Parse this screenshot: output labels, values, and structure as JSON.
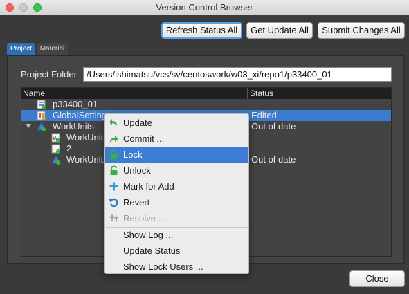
{
  "window": {
    "title": "Version Control Browser"
  },
  "toolbar": {
    "refresh_label": "Refresh Status All",
    "get_update_label": "Get Update All",
    "submit_label": "Submit Changes All"
  },
  "tabs": [
    {
      "label": "Project",
      "active": true
    },
    {
      "label": "Material",
      "active": false
    }
  ],
  "project_folder": {
    "label": "Project Folder",
    "value": "/Users/ishimatsu/vcs/sv/centoswork/w03_xi/repo1/p33400_01"
  },
  "tree": {
    "columns": {
      "name": "Name",
      "status": "Status"
    },
    "rows": [
      {
        "name": "p33400_01",
        "status": "",
        "icon": "project-file-icon",
        "selected": false
      },
      {
        "name": "GlobalSettings",
        "status": "Edited",
        "icon": "settings-file-icon",
        "selected": true
      },
      {
        "name": "WorkUnits",
        "status": "Out of date",
        "icon": "workunits-folder-icon",
        "selected": false,
        "expanded": true
      },
      {
        "name": "WorkUnits",
        "status": "",
        "icon": "workunit-file-icon",
        "selected": false
      },
      {
        "name": "2",
        "status": "",
        "icon": "document-icon",
        "selected": false
      },
      {
        "name": "WorkUnits",
        "status": "Out of date",
        "icon": "workunits-folder-icon",
        "selected": false
      }
    ]
  },
  "context_menu": {
    "items": [
      {
        "label": "Update",
        "icon": "update-arrow-icon",
        "enabled": true,
        "highlighted": false
      },
      {
        "label": "Commit ...",
        "icon": "commit-arrow-icon",
        "enabled": true,
        "highlighted": false
      },
      {
        "label": "Lock",
        "icon": "lock-icon",
        "enabled": true,
        "highlighted": true
      },
      {
        "label": "Unlock",
        "icon": "unlock-icon",
        "enabled": true,
        "highlighted": false
      },
      {
        "label": "Mark for Add",
        "icon": "plus-icon",
        "enabled": true,
        "highlighted": false
      },
      {
        "label": "Revert",
        "icon": "revert-icon",
        "enabled": true,
        "highlighted": false
      },
      {
        "label": "Resolve ...",
        "icon": "resolve-icon",
        "enabled": false,
        "highlighted": false
      },
      {
        "label": "Show Log ...",
        "icon": "",
        "enabled": true,
        "highlighted": false
      },
      {
        "label": "Update Status",
        "icon": "",
        "enabled": true,
        "highlighted": false
      },
      {
        "label": "Show Lock Users ...",
        "icon": "",
        "enabled": true,
        "highlighted": false
      }
    ]
  },
  "footer": {
    "close_label": "Close"
  },
  "colors": {
    "selection": "#3b7bd0",
    "menu_highlight": "#3d7cd3",
    "accent_green": "#34b64a",
    "accent_blue": "#2f86d6"
  }
}
